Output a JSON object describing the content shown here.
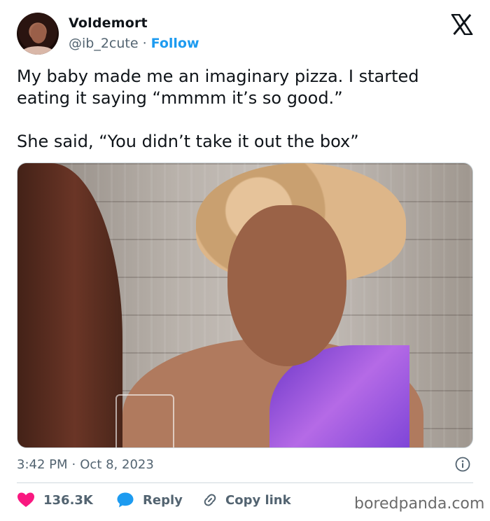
{
  "author": {
    "name": "Voldemort",
    "handle": "@ib_2cute",
    "separator": "·",
    "follow_label": "Follow"
  },
  "tweet": {
    "lines": [
      "My baby made me an imaginary pizza. I started eating it saying “mmmm it’s so good.”",
      "She said, “You didn’t take it out the box”"
    ],
    "time": "3:42 PM",
    "separator": "·",
    "date": "Oct 8, 2023"
  },
  "actions": {
    "likes": "136.3K",
    "reply_label": "Reply",
    "copy_label": "Copy link"
  },
  "icons": {
    "platform_logo": "x-logo-icon",
    "info": "info-icon",
    "like": "heart-icon",
    "reply": "reply-bubble-icon",
    "copy": "link-icon"
  },
  "colors": {
    "accent": "#1d9bf0",
    "heart": "#f91880",
    "muted": "#536471",
    "text": "#0f1419"
  },
  "watermark": "boredpanda.com"
}
